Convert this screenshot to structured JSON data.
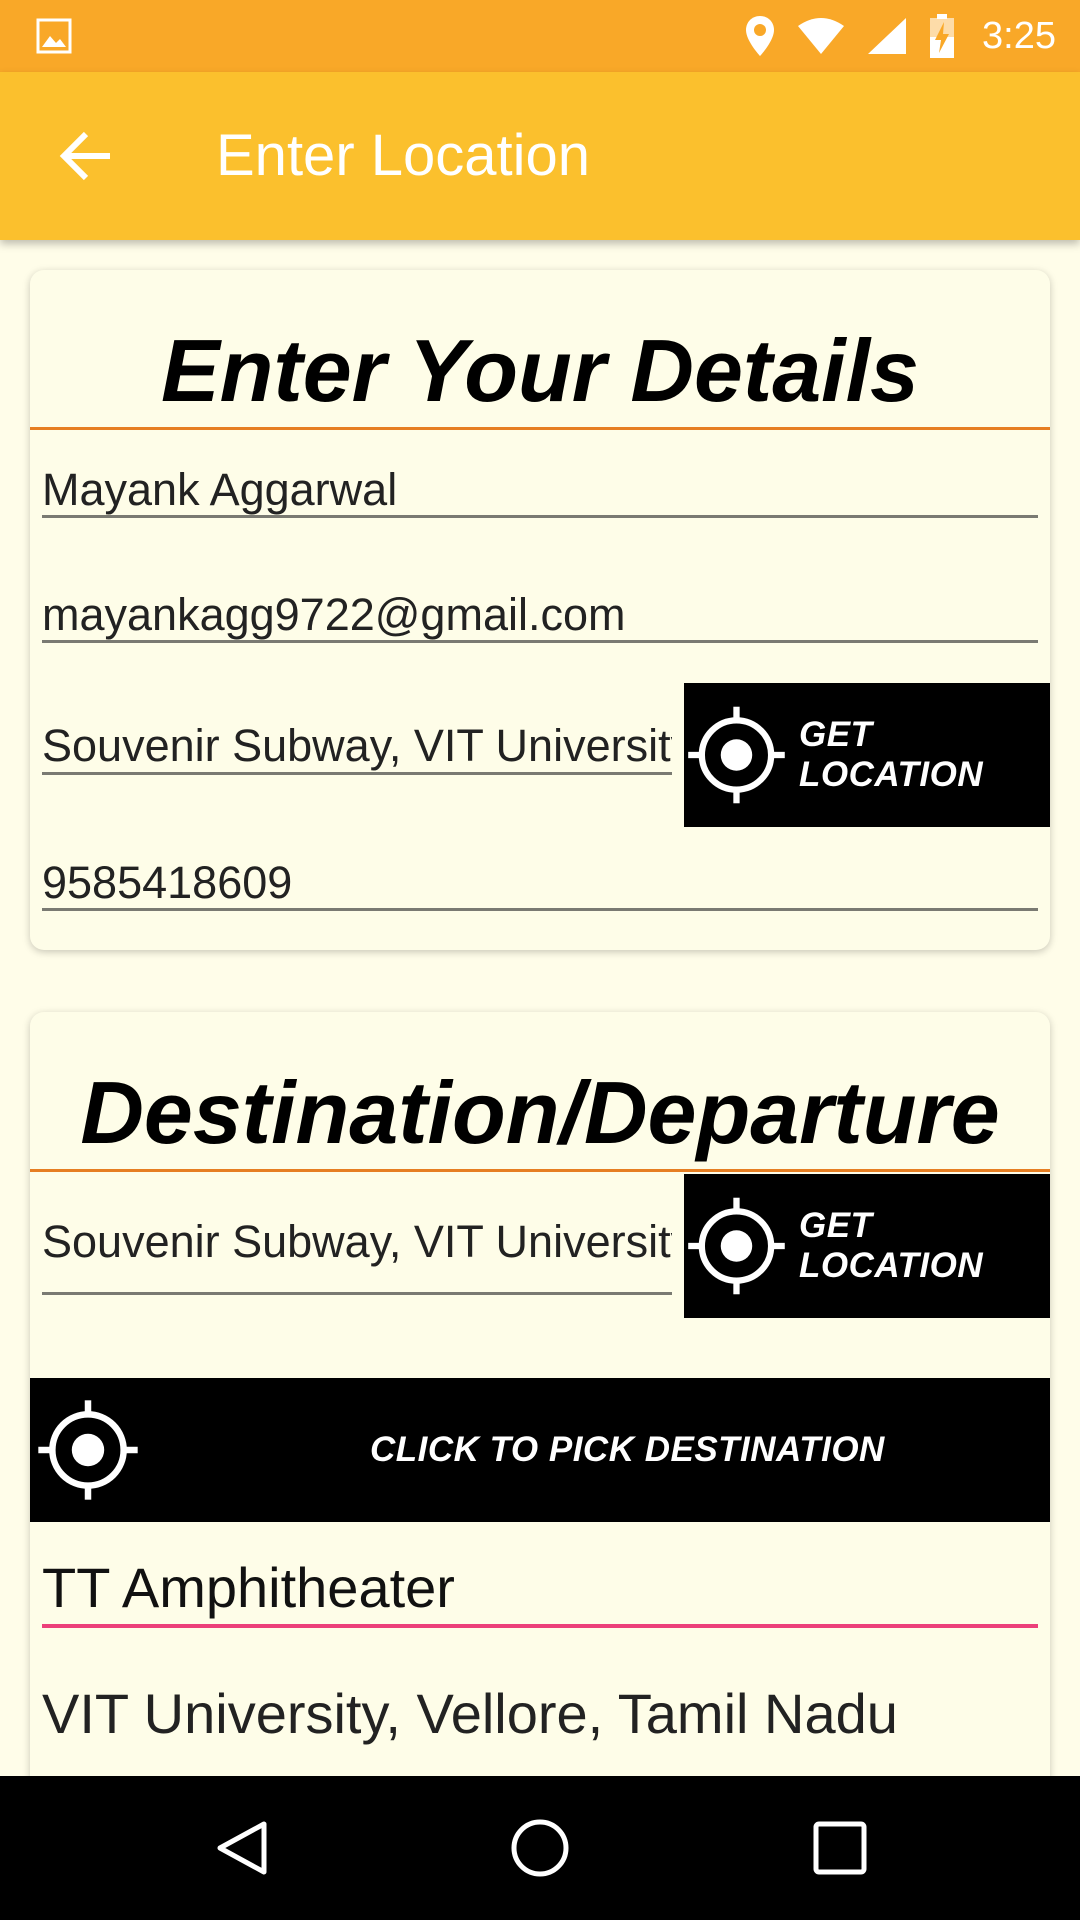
{
  "status_bar": {
    "time": "3:25",
    "icons": [
      "image-icon",
      "location-icon",
      "wifi-icon",
      "signal-icon",
      "battery-charging-icon"
    ]
  },
  "app_bar": {
    "title": "Enter Location",
    "back_icon": "arrow-left-icon"
  },
  "details_card": {
    "title": "Enter Your Details",
    "name_value": "Mayank Aggarwal",
    "email_value": "mayankagg9722@gmail.com",
    "location_value": "Souvenir Subway, VIT University, Vellore",
    "get_location_label": "GET LOCATION",
    "phone_value": "9585418609"
  },
  "destination_card": {
    "title": "Destination/Departure",
    "location_value": "Souvenir Subway, VIT University, Vellore",
    "get_location_label": "GET LOCATION",
    "pick_destination_label": "CLICK TO PICK DESTINATION",
    "destination_name_value": "TT Amphitheater",
    "destination_address_value": "VIT University, Vellore, Tamil Nadu"
  },
  "nav_bar": {
    "icons": [
      "back-triangle-icon",
      "home-circle-icon",
      "recents-square-icon"
    ]
  },
  "colors": {
    "status_bar": "#f9a828",
    "app_bar": "#fbc02d",
    "background": "#fffde9",
    "divider": "#e67e22",
    "active_underline": "#ec407a"
  }
}
